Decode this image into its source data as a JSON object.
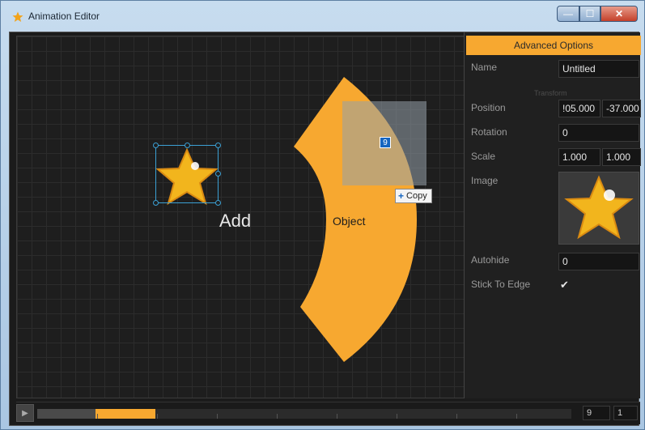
{
  "window": {
    "title": "Animation Editor",
    "minimize": "—",
    "maximize": "☐",
    "close": "✕"
  },
  "canvas": {
    "add_label": "Add",
    "object_label": "Object",
    "badge": "9",
    "copy_tip": "Copy",
    "copy_plus": "+"
  },
  "panel": {
    "header": "Advanced Options",
    "section_faint": "Transform",
    "name_label": "Name",
    "name_value": "Untitled",
    "position_label": "Position",
    "position_x": "!05.000",
    "position_y": "-37.000",
    "rotation_label": "Rotation",
    "rotation_value": "0",
    "scale_label": "Scale",
    "scale_x": "1.000",
    "scale_y": "1.000",
    "image_label": "Image",
    "autohide_label": "Autohide",
    "autohide_value": "0",
    "stick_label": "Stick To Edge",
    "stick_checked": "✔"
  },
  "timeline": {
    "play": "▶",
    "frame_a": "9",
    "frame_b": "1"
  },
  "colors": {
    "accent": "#f7a830",
    "selection": "#3ba0d4",
    "background": "#1e1e1e"
  }
}
